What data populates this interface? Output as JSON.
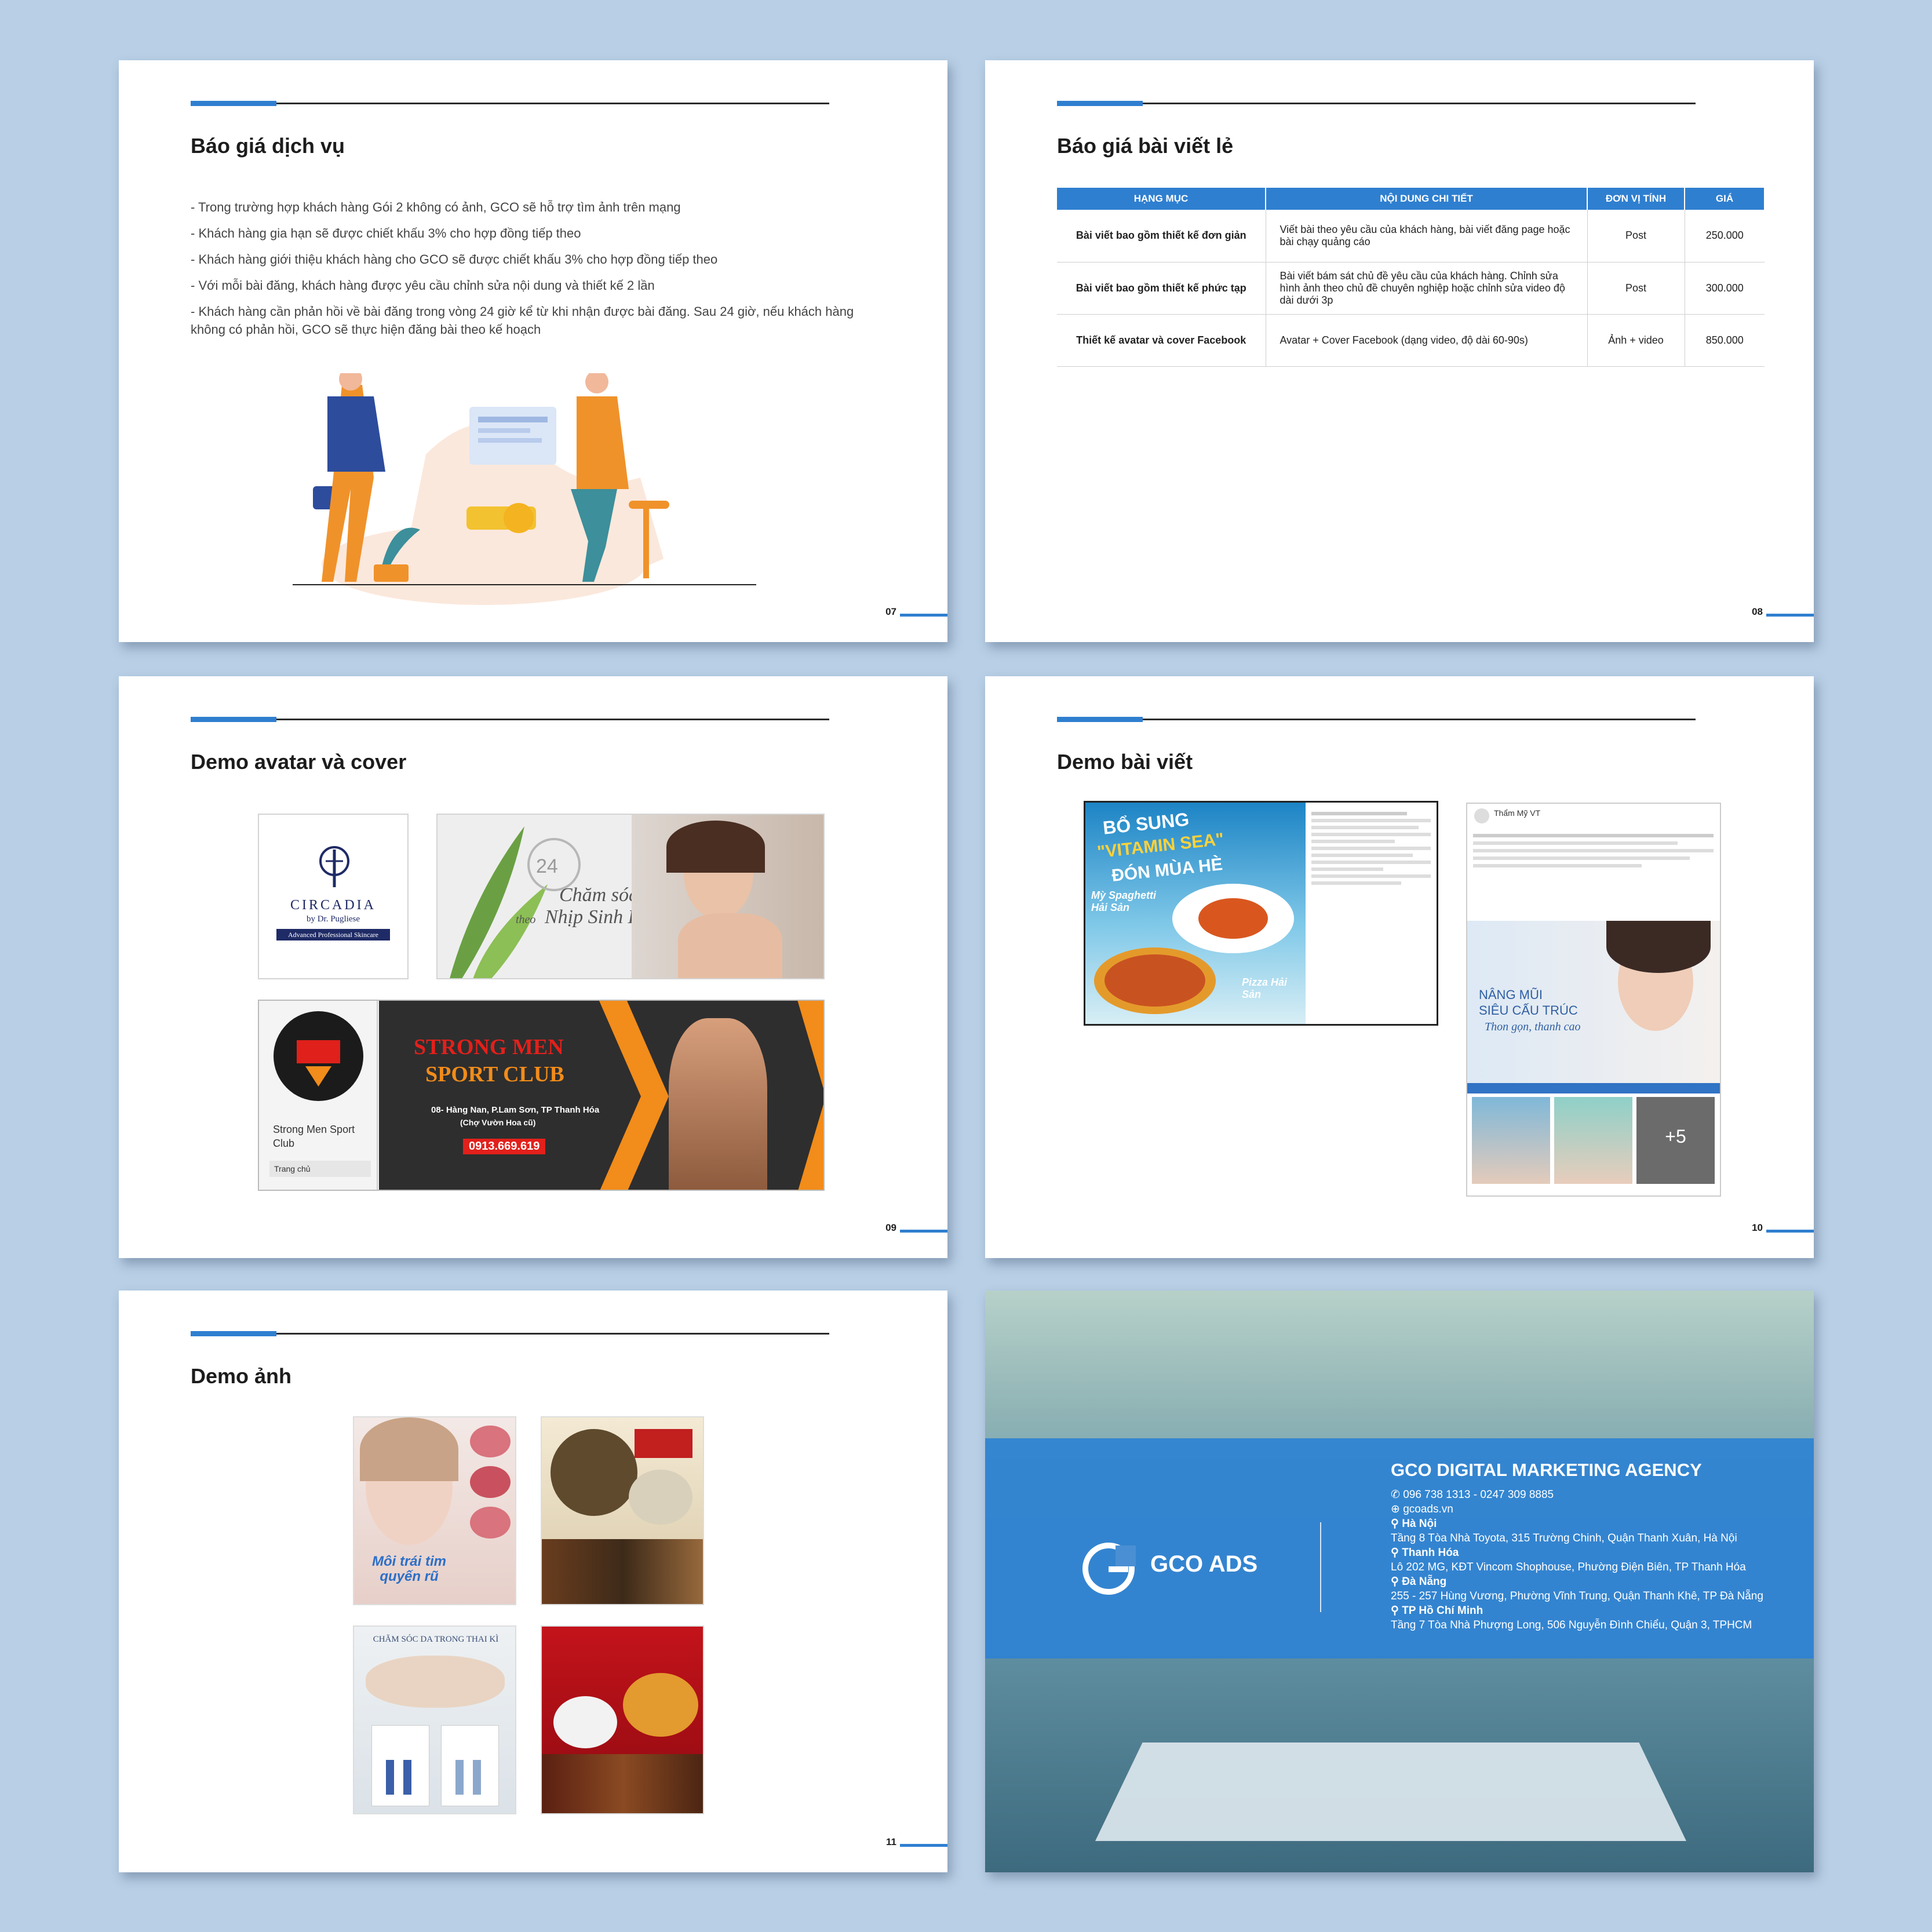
{
  "slide7": {
    "title": "Báo giá dịch vụ",
    "page": "07",
    "bullets": [
      "- Trong trường hợp khách hàng Gói 2 không có ảnh, GCO sẽ hỗ trợ tìm ảnh trên mạng",
      "- Khách hàng gia hạn sẽ được chiết khấu 3% cho hợp đồng tiếp theo",
      "- Khách hàng giới thiệu khách hàng cho GCO sẽ được chiết khấu 3% cho hợp đồng tiếp theo",
      "- Với mỗi bài đăng, khách hàng được yêu cầu chỉnh sửa nội dung và thiết kế 2 lần",
      "- Khách hàng cần phản hồi về bài đăng trong vòng 24 giờ kể từ khi nhận được bài đăng. Sau 24 giờ, nếu khách hàng không có phản hồi, GCO sẽ thực hiện đăng bài theo kế hoạch"
    ]
  },
  "slide8": {
    "title": "Báo giá bài viết lẻ",
    "page": "08",
    "headers": [
      "HẠNG MỤC",
      "NỘI DUNG CHI TIẾT",
      "ĐƠN VỊ TÍNH",
      "GIÁ"
    ],
    "rows": [
      {
        "cat": "Bài viết bao gồm thiết kế đơn giản",
        "det": "Viết bài theo yêu cầu của khách hàng, bài viết đăng page hoặc bài chạy quảng cáo",
        "unit": "Post",
        "price": "250.000"
      },
      {
        "cat": "Bài viết bao gồm thiết kế phức tạp",
        "det": "Bài viết bám sát chủ đề yêu cầu của khách hàng. Chỉnh sửa hình ảnh theo chủ đề chuyên nghiệp hoặc chỉnh sửa video độ dài dưới 3p",
        "unit": "Post",
        "price": "300.000"
      },
      {
        "cat": "Thiết kế avatar và cover Facebook",
        "det": "Avatar + Cover Facebook (dạng video, độ dài 60-90s)",
        "unit": "Ảnh + video",
        "price": "850.000"
      }
    ]
  },
  "slide9": {
    "title": "Demo avatar và cover",
    "page": "09",
    "logo_name": "CIRCADIA",
    "logo_by": "by Dr. Pugliese",
    "logo_tag": "Advanced Professional Skincare",
    "cover1_line1": "Chăm sóc da",
    "cover1_line2": "theo",
    "cover1_line3": "Nhịp Sinh Học",
    "cover1_clock": "24",
    "cover2_title1": "STRONG MEN",
    "cover2_title2": "SPORT CLUB",
    "cover2_addr": "08- Hàng Nan, P.Lam Sơn, TP Thanh Hóa",
    "cover2_addr2": "(Chợ Vườn Hoa cũ)",
    "cover2_phone": "0913.669.619",
    "page_name": "Strong Men Sport Club",
    "page_tab": "Trang chủ"
  },
  "slide10": {
    "title": "Demo bài viết",
    "page": "10",
    "post1_head1": "BỔ SUNG",
    "post1_head2": "\"VITAMIN SEA\"",
    "post1_head3": "ĐÓN MÙA HÈ",
    "post1_dish1": "Mỳ Spaghetti Hải Sản",
    "post1_dish2": "Pizza Hải Sản",
    "post2_page": "Thẩm Mỹ VT",
    "post2_head1": "NÂNG MŨI",
    "post2_head2": "SIÊU CẤU TRÚC",
    "post2_head3": "Thon gọn, thanh cao",
    "post2_more": "+5"
  },
  "slide11": {
    "title": "Demo ảnh",
    "page": "11",
    "photo1": "Môi trái tim quyến rũ",
    "photo3": "CHĂM SÓC DA TRONG THAI KÌ"
  },
  "slide12": {
    "brand": "GCO ADS",
    "agency": "GCO DIGITAL MARKETING AGENCY",
    "phone": "096 738 1313 - 0247 309 8885",
    "web": "gcoads.vn",
    "offices": [
      {
        "city": "Hà Nội",
        "addr": "Tầng 8 Tòa Nhà Toyota, 315 Trường Chinh, Quận Thanh Xuân, Hà Nội"
      },
      {
        "city": "Thanh Hóa",
        "addr": "Lô 202 MG, KĐT Vincom Shophouse, Phường Điện Biên, TP Thanh Hóa"
      },
      {
        "city": "Đà Nẵng",
        "addr": "255 - 257 Hùng Vương, Phường Vĩnh Trung, Quận Thanh Khê, TP Đà Nẵng"
      },
      {
        "city": "TP Hồ Chí Minh",
        "addr": "Tầng 7 Tòa Nhà Phượng Long, 506 Nguyễn Đình Chiểu, Quận 3, TPHCM"
      }
    ]
  },
  "colors": {
    "accent": "#2f7fd0",
    "background": "#b8cfe6"
  }
}
